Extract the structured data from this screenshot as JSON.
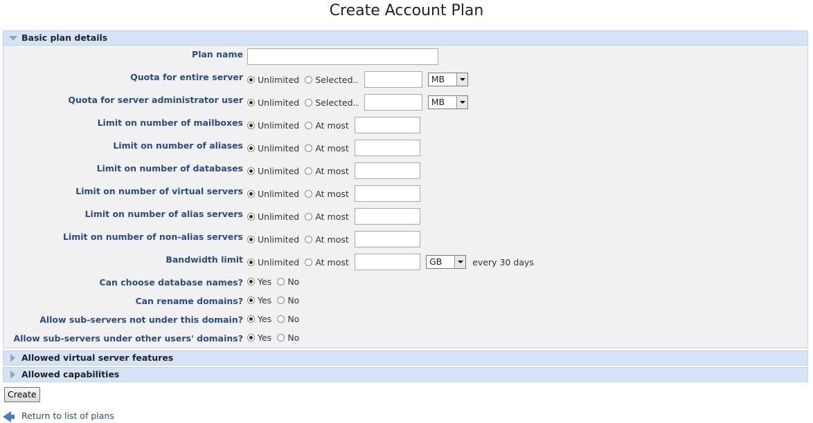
{
  "page": {
    "title": "Create Account Plan"
  },
  "sections": {
    "basic": "Basic plan details",
    "features": "Allowed virtual server features",
    "capabilities": "Allowed capabilities"
  },
  "fields": [
    {
      "label": "Plan name",
      "type": "text",
      "value": ""
    },
    {
      "label": "Quota for entire server",
      "type": "quota",
      "opt1": "Unlimited",
      "opt2": "Selected..",
      "selected": "opt1",
      "value": "",
      "unit": "MB"
    },
    {
      "label": "Quota for server administrator user",
      "type": "quota",
      "opt1": "Unlimited",
      "opt2": "Selected..",
      "selected": "opt1",
      "value": "",
      "unit": "MB"
    },
    {
      "label": "Limit on number of mailboxes",
      "type": "limit",
      "opt1": "Unlimited",
      "opt2": "At most",
      "selected": "opt1",
      "value": ""
    },
    {
      "label": "Limit on number of aliases",
      "type": "limit",
      "opt1": "Unlimited",
      "opt2": "At most",
      "selected": "opt1",
      "value": ""
    },
    {
      "label": "Limit on number of databases",
      "type": "limit",
      "opt1": "Unlimited",
      "opt2": "At most",
      "selected": "opt1",
      "value": ""
    },
    {
      "label": "Limit on number of virtual servers",
      "type": "limit",
      "opt1": "Unlimited",
      "opt2": "At most",
      "selected": "opt1",
      "value": ""
    },
    {
      "label": "Limit on number of alias servers",
      "type": "limit",
      "opt1": "Unlimited",
      "opt2": "At most",
      "selected": "opt1",
      "value": ""
    },
    {
      "label": "Limit on number of non-alias servers",
      "type": "limit",
      "opt1": "Unlimited",
      "opt2": "At most",
      "selected": "opt1",
      "value": ""
    },
    {
      "label": "Bandwidth limit",
      "type": "bandwidth",
      "opt1": "Unlimited",
      "opt2": "At most",
      "selected": "opt1",
      "value": "",
      "unit": "GB",
      "suffix": "every 30 days"
    },
    {
      "label": "Can choose database names?",
      "type": "yesno",
      "opt1": "Yes",
      "opt2": "No",
      "selected": "opt1"
    },
    {
      "label": "Can rename domains?",
      "type": "yesno",
      "opt1": "Yes",
      "opt2": "No",
      "selected": "opt1"
    },
    {
      "label": "Allow sub-servers not under this domain?",
      "type": "yesno",
      "opt1": "Yes",
      "opt2": "No",
      "selected": "opt1"
    },
    {
      "label": "Allow sub-servers under other users' domains?",
      "type": "yesno",
      "opt1": "Yes",
      "opt2": "No",
      "selected": "opt1"
    }
  ],
  "actions": {
    "create": "Create",
    "back": "Return to list of plans"
  },
  "colors": {
    "label": "#2a4d8a",
    "section_header": "#d5e3f7",
    "panel_bg": "#f1f1f1"
  }
}
